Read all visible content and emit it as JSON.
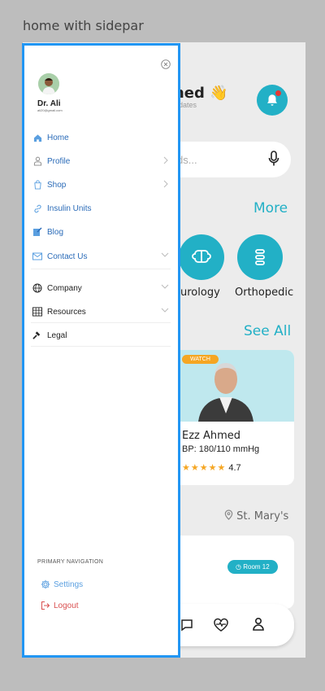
{
  "frame_title": "home with sidepar",
  "app": {
    "greeting": "med 👋",
    "greeting_sub": "dates",
    "search_placeholder": "ds...",
    "more_label": "More",
    "categories": [
      {
        "label": "eurology",
        "icon": "brain-icon"
      },
      {
        "label": "Orthopedic",
        "icon": "spine-icon"
      }
    ],
    "see_all_label": "See All",
    "doctor": {
      "badge": "WATCH",
      "name": "Ezz Ahmed",
      "bp": "BP: 180/110 mmHg",
      "stars": "★★★★★",
      "rating": "4.7"
    },
    "location": "St. Mary's",
    "room": "Room 12"
  },
  "sidebar": {
    "user": {
      "name": "Dr. Ali",
      "email": "ali20@gmail.com"
    },
    "items": [
      {
        "label": "Home",
        "icon": "home-icon",
        "chevron": ""
      },
      {
        "label": "Profile",
        "icon": "user-icon",
        "chevron": "right"
      },
      {
        "label": "Shop",
        "icon": "shopping-bag-icon",
        "chevron": "right"
      },
      {
        "label": "Insulin Units",
        "icon": "link-icon",
        "chevron": ""
      },
      {
        "label": "Blog",
        "icon": "edit-icon",
        "chevron": ""
      },
      {
        "label": "Contact Us",
        "icon": "mail-icon",
        "chevron": "down"
      },
      {
        "label": "Company",
        "icon": "globe-icon",
        "chevron": "down"
      },
      {
        "label": "Resources",
        "icon": "building-icon",
        "chevron": "down"
      },
      {
        "label": "Legal",
        "icon": "gavel-icon",
        "chevron": ""
      }
    ],
    "section_label": "PRIMARY NAVIGATION",
    "settings_label": "Settings",
    "logout_label": "Logout"
  },
  "colors": {
    "accent": "#22b0c6",
    "nav_blue": "#2a6bb8",
    "logout": "#d94f4f",
    "border": "#2196f3"
  }
}
